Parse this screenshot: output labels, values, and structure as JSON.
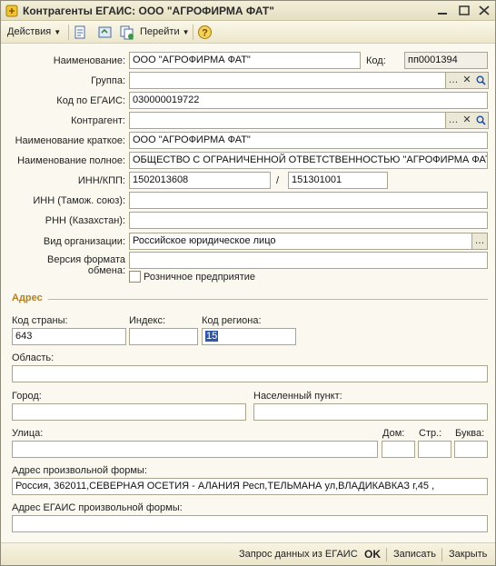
{
  "window": {
    "title": "Контрагенты ЕГАИС: ООО \"АГРОФИРМА ФАТ\""
  },
  "toolbar": {
    "actions_label": "Действия",
    "goto_label": "Перейти"
  },
  "form": {
    "name_label": "Наименование:",
    "name_value": "ООО \"АГРОФИРМА ФАТ\"",
    "code_label": "Код:",
    "code_value": "пп0001394",
    "group_label": "Группа:",
    "group_value": "",
    "egais_code_label": "Код по ЕГАИС:",
    "egais_code_value": "030000019722",
    "counterparty_label": "Контрагент:",
    "counterparty_value": "",
    "short_name_label": "Наименование краткое:",
    "short_name_value": "ООО \"АГРОФИРМА ФАТ\"",
    "full_name_label": "Наименование полное:",
    "full_name_value": "ОБЩЕСТВО С ОГРАНИЧЕННОЙ ОТВЕТСТВЕННОСТЬЮ \"АГРОФИРМА  ФАТ\"",
    "inn_kpp_label": "ИНН/КПП:",
    "inn_value": "1502013608",
    "kpp_separator": "/",
    "kpp_value": "151301001",
    "inn_customs_label": "ИНН (Тамож. союз):",
    "inn_customs_value": "",
    "rnn_label": "РНН (Казахстан):",
    "rnn_value": "",
    "org_type_label": "Вид организации:",
    "org_type_value": "Российское юридическое лицо",
    "format_version_label_1": "Версия формата",
    "format_version_label_2": "обмена:",
    "format_version_value": "",
    "retail_label": "Розничное предприятие",
    "retail_checked": false
  },
  "address": {
    "section_title": "Адрес",
    "country_code_label": "Код страны:",
    "country_code_value": "643",
    "index_label": "Индекс:",
    "index_value": "",
    "region_code_label": "Код региона:",
    "region_code_value": "15",
    "region_label": "Область:",
    "region_value": "",
    "city_label": "Город:",
    "city_value": "",
    "locality_label": "Населенный пункт:",
    "locality_value": "",
    "street_label": "Улица:",
    "street_value": "",
    "house_label": "Дом:",
    "house_value": "",
    "building_label": "Стр.:",
    "building_value": "",
    "letter_label": "Буква:",
    "letter_value": "",
    "free_form_label": "Адрес произвольной формы:",
    "free_form_value": "Россия, 362011,СЕВЕРНАЯ ОСЕТИЯ - АЛАНИЯ Респ,ТЕЛЬМАНА ул,ВЛАДИКАВКАЗ г,45 ,",
    "egais_free_form_label": "Адрес ЕГАИС произвольной формы:",
    "egais_free_form_value": ""
  },
  "footer": {
    "request_label": "Запрос данных из ЕГАИС",
    "ok_label": "OK",
    "save_label": "Записать",
    "close_label": "Закрыть"
  },
  "icons": {
    "app": "app-icon",
    "minimize": "minimize-icon",
    "maximize": "maximize-icon",
    "close": "close-icon",
    "post": "post-document-icon",
    "structure": "structure-icon",
    "copy": "copy-icon",
    "help": "help-icon",
    "select": "ellipsis-icon",
    "clear": "clear-x-icon",
    "open": "magnifier-icon"
  },
  "colors": {
    "accent": "#b5801f",
    "background": "#fbf9ef",
    "selection": "#2f57a8"
  }
}
